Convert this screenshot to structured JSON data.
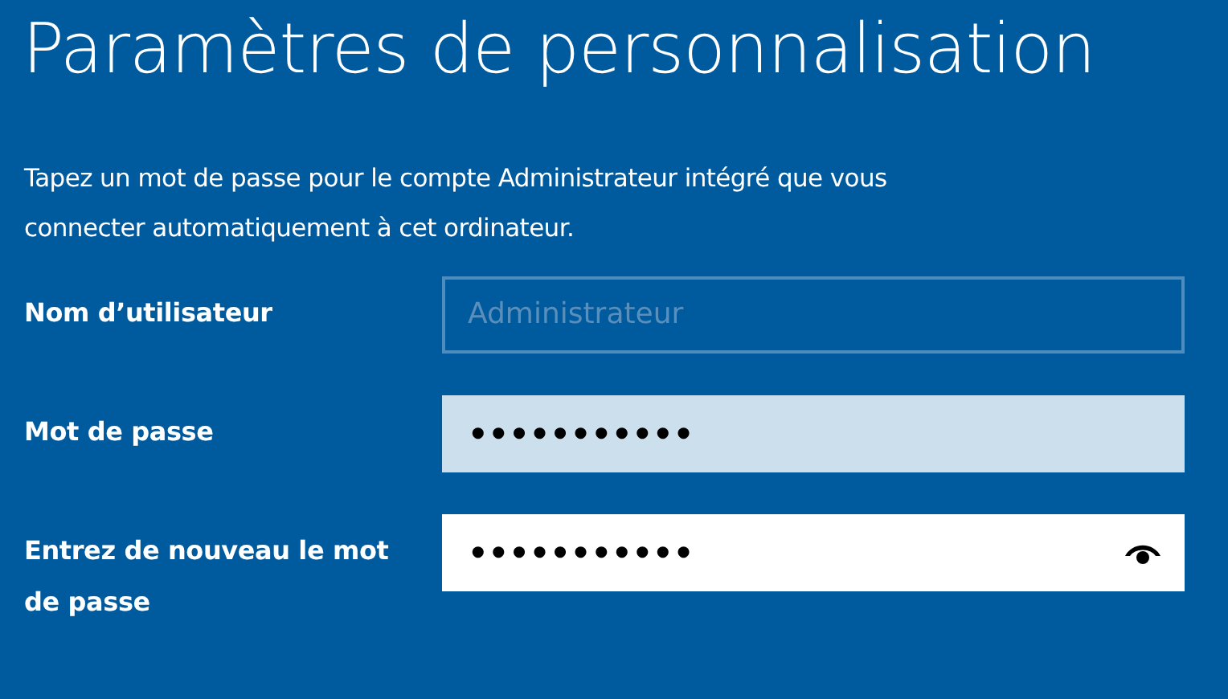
{
  "title": "Paramètres de personnalisation",
  "description_lines": [
    "Tapez un mot de passe pour le compte Administrateur intégré que vous",
    "connecter automatiquement à cet ordinateur."
  ],
  "fields": [
    {
      "label": "Nom d’utilisateur",
      "kind": "text",
      "placeholder": "Administrateur",
      "disabled": true,
      "hovered": false,
      "reveal": false
    },
    {
      "label": "Mot de passe",
      "kind": "password",
      "value": "•••••••••••",
      "disabled": false,
      "hovered": true,
      "reveal": false
    },
    {
      "label": "Entrez de nouveau le mot de passe",
      "kind": "password",
      "value": "•••••••••••",
      "disabled": false,
      "hovered": false,
      "reveal": true
    }
  ]
}
